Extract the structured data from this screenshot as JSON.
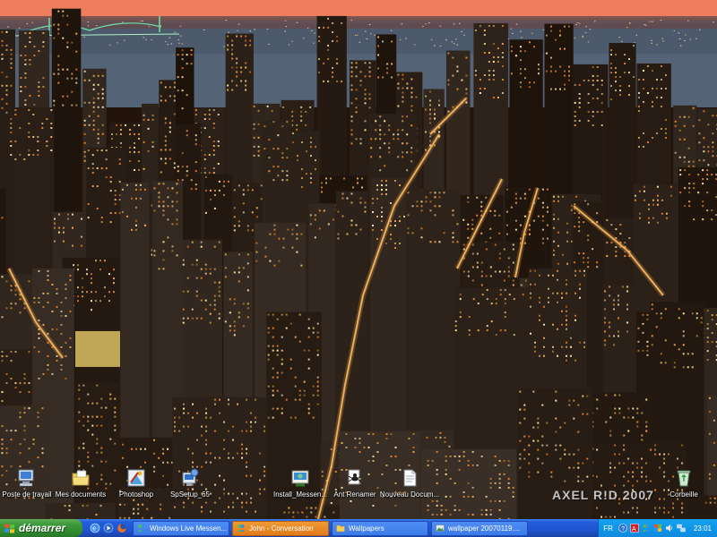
{
  "desktop": {
    "icons": [
      {
        "label": "Poste de travail",
        "icon": "my-computer-icon"
      },
      {
        "label": "Mes documents",
        "icon": "my-documents-icon"
      },
      {
        "label": "Photoshop",
        "icon": "photoshop-icon"
      },
      {
        "label": "SpSetup_65",
        "icon": "setup-icon"
      },
      {
        "label": "Install_Messen...",
        "icon": "installer-icon"
      },
      {
        "label": "Ant Renamer",
        "icon": "ant-renamer-icon"
      },
      {
        "label": "Nouveau Docum...",
        "icon": "text-document-icon"
      },
      {
        "label": "Corbeille",
        "icon": "recycle-bin-icon"
      }
    ],
    "watermark": "AXEL R!D 2007"
  },
  "taskbar": {
    "start_label": "démarrer",
    "quick_launch": [
      "ie-icon",
      "media-player-icon",
      "firefox-icon"
    ],
    "tasks": [
      {
        "label": "Windows Live Messen...",
        "icon": "messenger-icon",
        "active": false
      },
      {
        "label": "John - Conversation",
        "icon": "conversation-icon",
        "active": true
      },
      {
        "label": "Wallpapers",
        "icon": "folder-icon",
        "active": false
      },
      {
        "label": "wallpaper 20070119....",
        "icon": "image-viewer-icon",
        "active": false
      }
    ],
    "tray": {
      "language": "FR",
      "clock": "23:01"
    }
  },
  "colors": {
    "taskbar_blue": "#245edb",
    "start_green": "#3c9a3a",
    "active_task_orange": "#f09a34",
    "tray_blue": "#0f8ade"
  }
}
